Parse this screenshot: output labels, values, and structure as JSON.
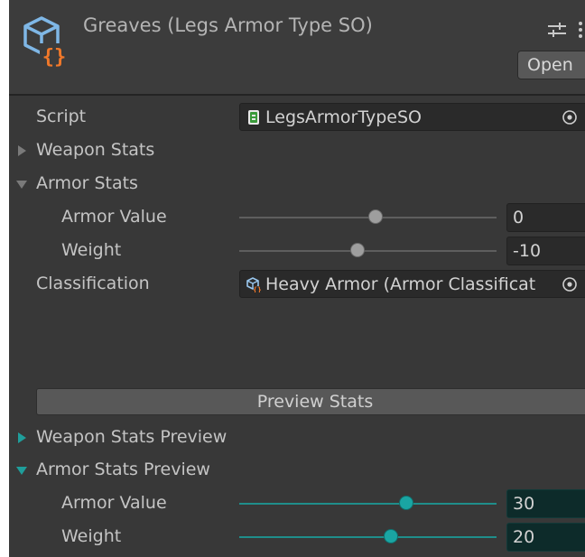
{
  "header": {
    "title": "Greaves (Legs Armor Type SO)",
    "open_label": "Open",
    "icons": [
      "scriptable-object-icon",
      "settings-sliders-icon",
      "more-vertical-icon"
    ]
  },
  "fields": {
    "script": {
      "label": "Script",
      "value": "LegsArmorTypeSO",
      "icon": "script-file-icon"
    },
    "weapon_stats": {
      "label": "Weapon Stats",
      "expanded": false
    },
    "armor_stats": {
      "label": "Armor Stats",
      "expanded": true,
      "armor_value": {
        "label": "Armor Value",
        "value": "0",
        "slider_fraction": 0.53
      },
      "weight": {
        "label": "Weight",
        "value": "-10",
        "slider_fraction": 0.46
      }
    },
    "classification": {
      "label": "Classification",
      "value": "Heavy Armor (Armor Classificat",
      "icon": "scriptable-object-icon"
    }
  },
  "preview": {
    "button_label": "Preview Stats",
    "weapon_stats_preview": {
      "label": "Weapon Stats Preview",
      "expanded": false
    },
    "armor_stats_preview": {
      "label": "Armor Stats Preview",
      "expanded": true,
      "armor_value": {
        "label": "Armor Value",
        "value": "30",
        "slider_fraction": 0.65
      },
      "weight": {
        "label": "Weight",
        "value": "20",
        "slider_fraction": 0.59
      }
    }
  },
  "colors": {
    "panel": "#383838",
    "accent_teal": "#1aa5a3",
    "icon_orange": "#f0782a",
    "icon_blue": "#7fb7e6"
  }
}
